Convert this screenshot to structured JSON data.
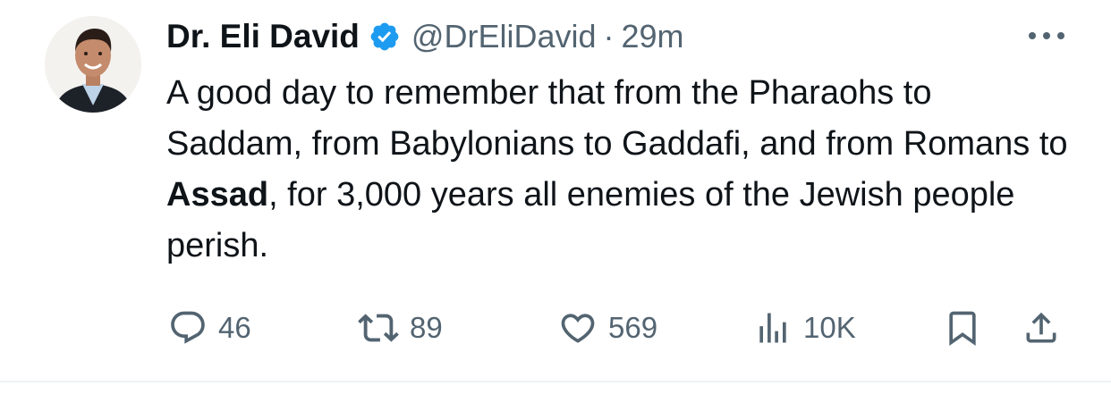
{
  "author": {
    "name": "Dr. Eli David",
    "handle": "@DrEliDavid",
    "separator": "·",
    "time": "29m",
    "verified_icon": "verified-badge-icon"
  },
  "tweet": {
    "text_part1": "A good day to remember that from the Pharaohs to Saddam, from Babylonians to Gaddafi, and from Romans to ",
    "text_bold": "Assad",
    "text_part2": ", for 3,000 years all enemies of the Jewish people perish."
  },
  "actions": {
    "replies": "46",
    "retweets": "89",
    "likes": "569",
    "views": "10K"
  },
  "colors": {
    "text": "#0f1419",
    "muted": "#536471",
    "verified": "#1d9bf0",
    "divider": "#eff3f4"
  }
}
